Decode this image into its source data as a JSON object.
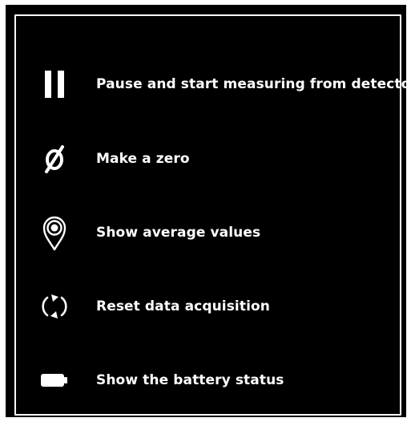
{
  "legend": {
    "items": [
      {
        "icon": "pause-icon",
        "label": "Pause and start measuring from detector"
      },
      {
        "icon": "zero-icon",
        "label": "Make a zero"
      },
      {
        "icon": "location-pin-icon",
        "label": "Show average values"
      },
      {
        "icon": "refresh-icon",
        "label": "Reset data acquisition"
      },
      {
        "icon": "battery-icon",
        "label": "Show the battery status"
      }
    ],
    "colors": {
      "background": "#000000",
      "foreground": "#ffffff"
    }
  }
}
